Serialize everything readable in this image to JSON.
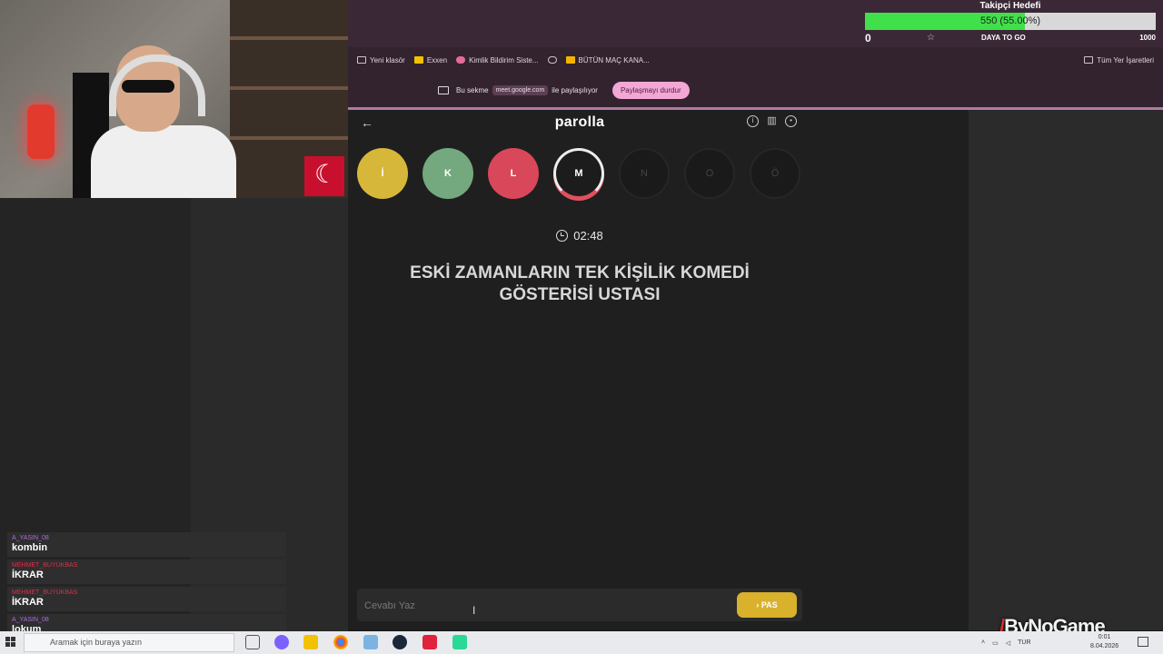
{
  "follower_goal": {
    "title": "Takipçi Hedefi",
    "progress_text": "550 (55.00%)",
    "progress_fraction": 0.55,
    "left_value": "0",
    "right_value": "1000",
    "bar_color": "#40e04a"
  },
  "browser": {
    "toolbar_text": "DAYA TO GO",
    "bookmarks": [
      "Yeni klasör",
      "Exxen",
      "Kimlik Bildirim Siste...",
      "BÜTÜN MAÇ KANA..."
    ],
    "all_bookmarks": "Tüm Yer İşaretleri",
    "share_bar": {
      "prefix": "Bu sekme",
      "site": "meet.google.com",
      "suffix": "ile paylaşılıyor",
      "stop_button": "Paylaşmayı durdur"
    }
  },
  "app": {
    "logo": "parolla",
    "letters": [
      {
        "char": "İ",
        "state": "answered",
        "color": "#d7b73a"
      },
      {
        "char": "K",
        "state": "correct",
        "color": "#74a87e"
      },
      {
        "char": "L",
        "state": "wrong",
        "color": "#d9475a"
      },
      {
        "char": "M",
        "state": "active",
        "color": "#1c1c1c"
      },
      {
        "char": "N",
        "state": "pending",
        "color": "#1a1a1a"
      },
      {
        "char": "O",
        "state": "pending",
        "color": "#1a1a1a"
      },
      {
        "char": "Ö",
        "state": "pending",
        "color": "#1a1a1a"
      }
    ],
    "timer": "02:48",
    "question_line1": "ESKİ ZAMANLARIN TEK KİŞİLİK KOMEDİ",
    "question_line2": "GÖSTERİSİ USTASI",
    "answer_placeholder": "Cevabı Yaz",
    "pass_button": "PAS",
    "icons": [
      "info-icon",
      "stats-icon",
      "profile-icon"
    ]
  },
  "chat": [
    {
      "user": "A_YASIN_08",
      "user_color": "#b06be0",
      "text": "kombin"
    },
    {
      "user": "MEHMET_BUYUKBAS",
      "user_color": "#d9304a",
      "text": "İKRAR"
    },
    {
      "user": "MEHMET_BUYUKBAS",
      "user_color": "#d9304a",
      "text": "İKRAR"
    },
    {
      "user": "A_YASIN_08",
      "user_color": "#b06be0",
      "text": "lokum"
    }
  ],
  "taskbar": {
    "search_placeholder": "Aramak için buraya yazın",
    "language": "TUR",
    "time": "0:01",
    "date": "8.04.2026"
  },
  "watermark": {
    "prefix": "/",
    "name": "ByNoGame"
  }
}
